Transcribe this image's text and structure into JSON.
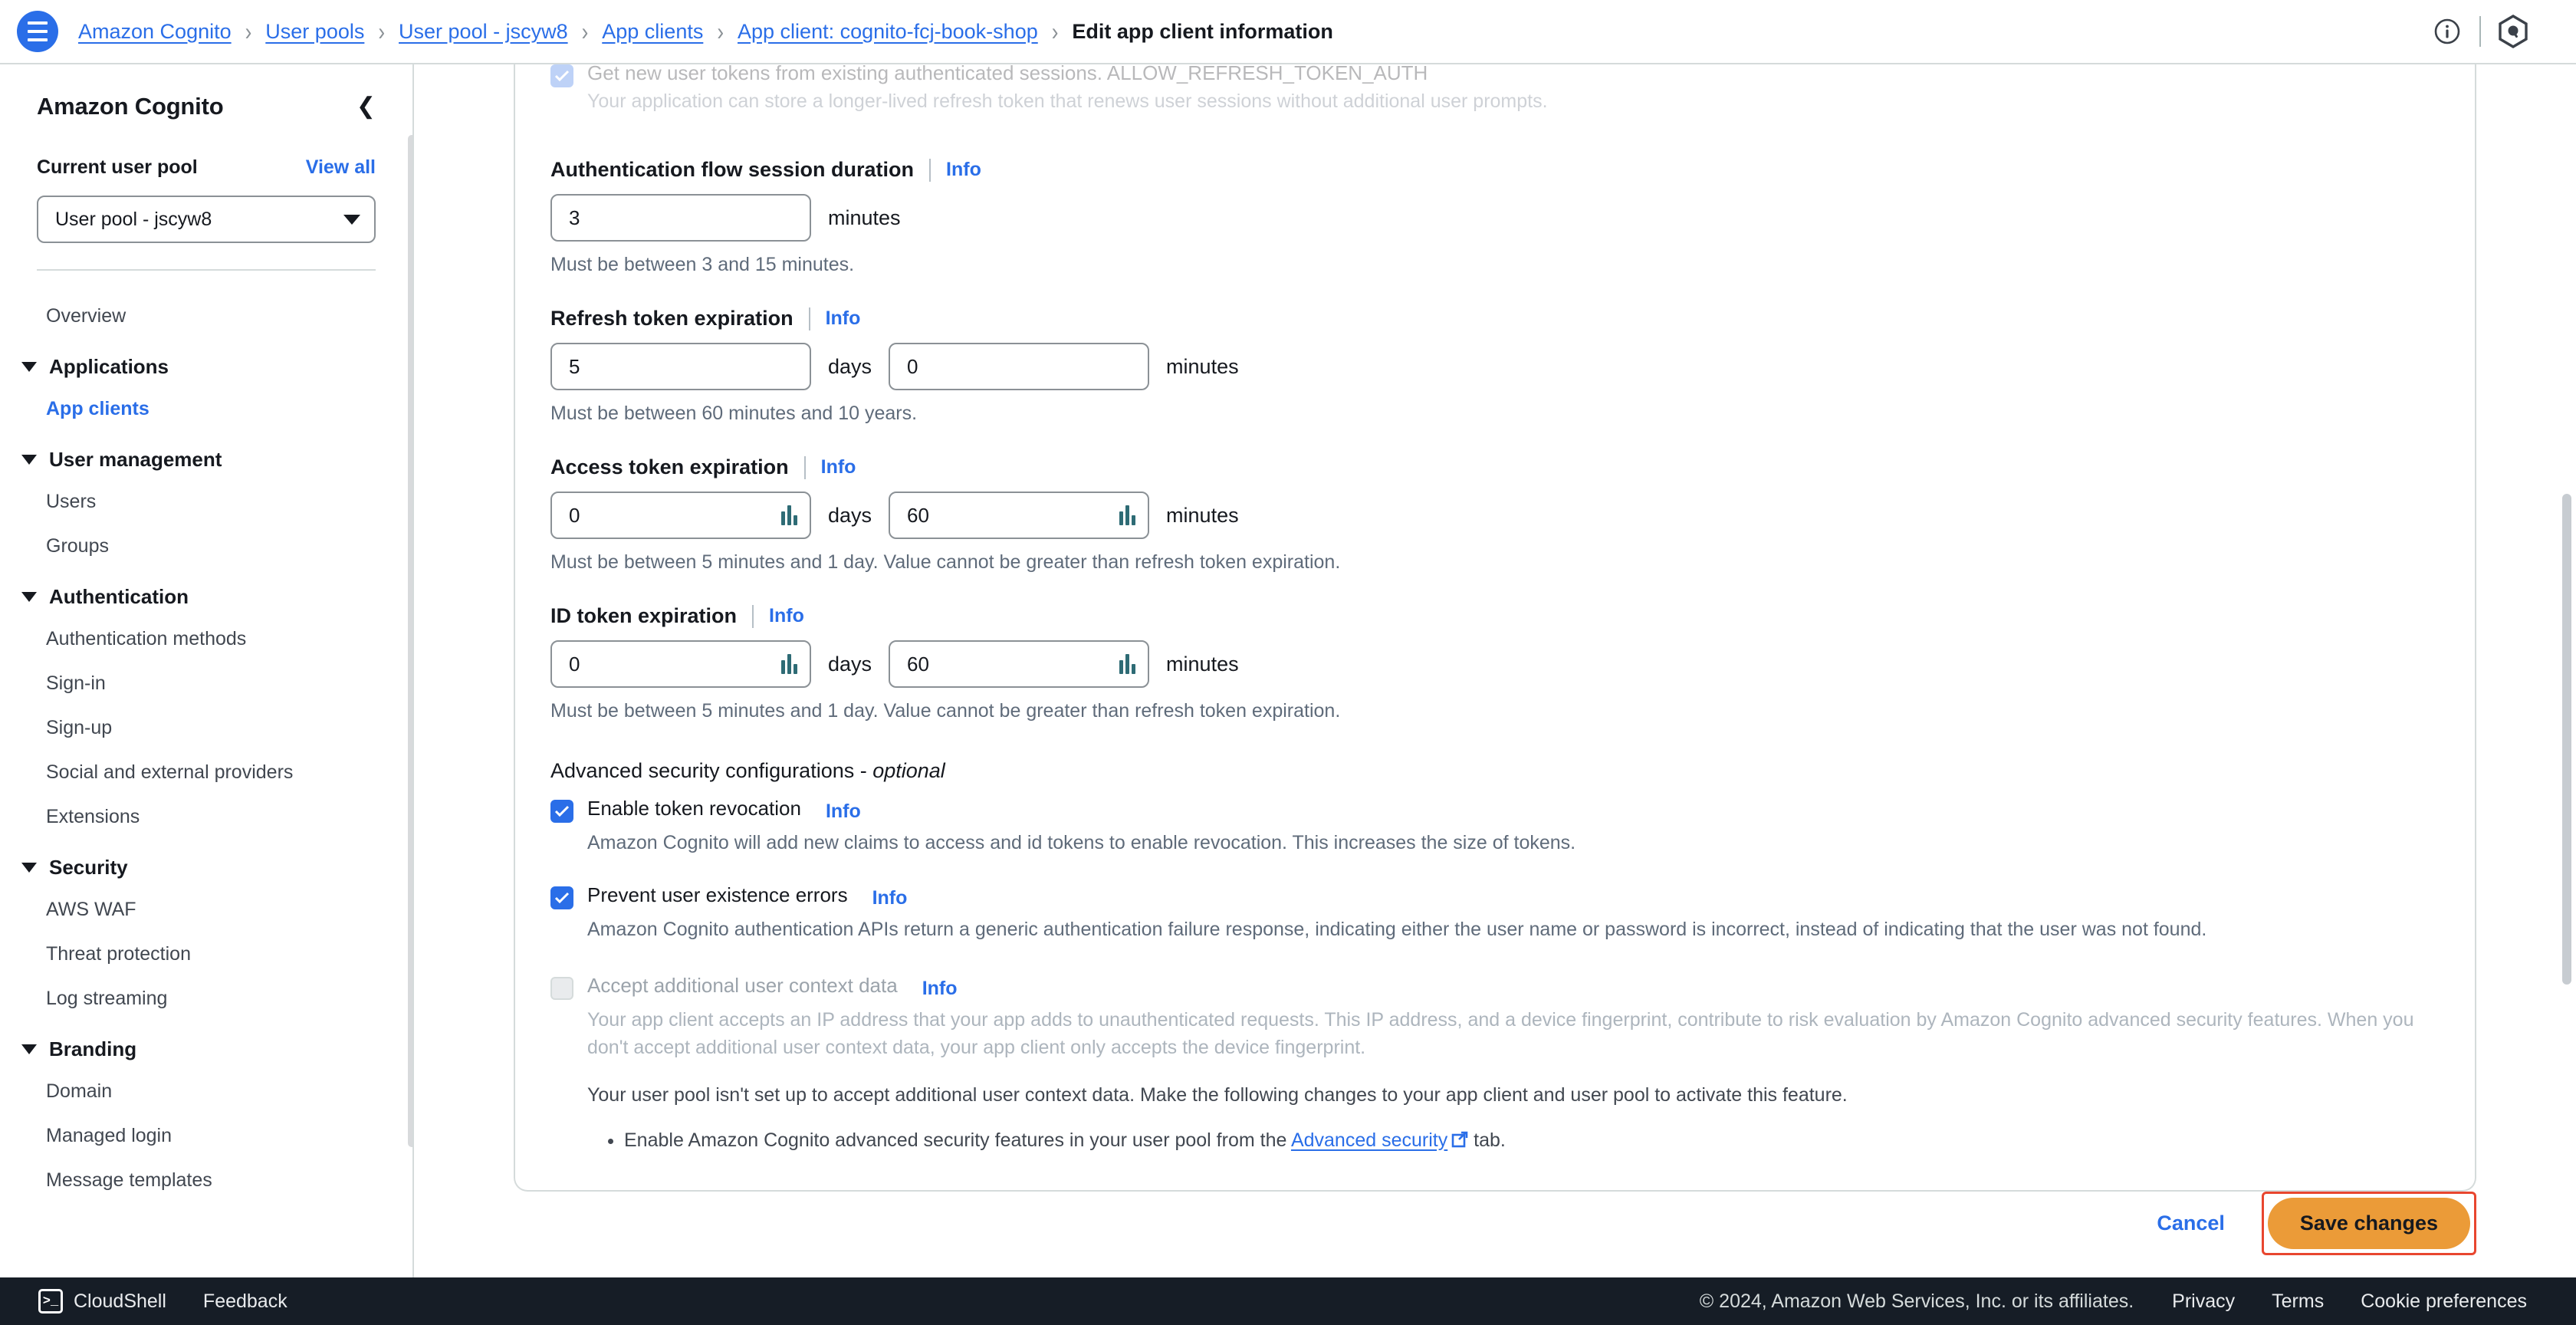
{
  "topnav": {
    "menu_icon": "hamburger-menu-icon",
    "breadcrumbs": [
      {
        "label": "Amazon Cognito",
        "current": false
      },
      {
        "label": "User pools",
        "current": false
      },
      {
        "label": "User pool - jscyw8",
        "current": false
      },
      {
        "label": "App clients",
        "current": false
      },
      {
        "label": "App client: cognito-fcj-book-shop",
        "current": false
      },
      {
        "label": "Edit app client information",
        "current": true
      }
    ],
    "separator": "›",
    "info_icon": "info-circle-icon",
    "assistant_icon": "amazon-q-hexagon-icon"
  },
  "sidebar": {
    "title": "Amazon Cognito",
    "collapse_icon": "chevron-left-icon",
    "current_pool_label": "Current user pool",
    "view_all_label": "View all",
    "pool_select_value": "User pool - jscyw8",
    "nav": [
      {
        "type": "link",
        "label": "Overview",
        "active": false
      },
      {
        "type": "group",
        "label": "Applications",
        "expanded": true
      },
      {
        "type": "link",
        "label": "App clients",
        "active": true
      },
      {
        "type": "group",
        "label": "User management",
        "expanded": true
      },
      {
        "type": "link",
        "label": "Users",
        "active": false
      },
      {
        "type": "link",
        "label": "Groups",
        "active": false
      },
      {
        "type": "group",
        "label": "Authentication",
        "expanded": true
      },
      {
        "type": "link",
        "label": "Authentication methods",
        "active": false
      },
      {
        "type": "link",
        "label": "Sign-in",
        "active": false
      },
      {
        "type": "link",
        "label": "Sign-up",
        "active": false
      },
      {
        "type": "link",
        "label": "Social and external providers",
        "active": false
      },
      {
        "type": "link",
        "label": "Extensions",
        "active": false
      },
      {
        "type": "group",
        "label": "Security",
        "expanded": true
      },
      {
        "type": "link",
        "label": "AWS WAF",
        "active": false
      },
      {
        "type": "link",
        "label": "Threat protection",
        "active": false
      },
      {
        "type": "link",
        "label": "Log streaming",
        "active": false
      },
      {
        "type": "group",
        "label": "Branding",
        "expanded": true
      },
      {
        "type": "link",
        "label": "Domain",
        "active": false
      },
      {
        "type": "link",
        "label": "Managed login",
        "active": false
      },
      {
        "type": "link",
        "label": "Message templates",
        "active": false
      }
    ]
  },
  "form": {
    "cutoff_checkbox": {
      "label": "Get new user tokens from existing authenticated sessions. ALLOW_REFRESH_TOKEN_AUTH",
      "description": "Your application can store a longer-lived refresh token that renews user sessions without additional user prompts.",
      "checked": true,
      "disabled": true
    },
    "info_label": "Info",
    "auth_flow_session": {
      "label": "Authentication flow session duration",
      "value": "3",
      "unit": "minutes",
      "hint": "Must be between 3 and 15 minutes."
    },
    "refresh_token": {
      "label": "Refresh token expiration",
      "days_value": "5",
      "days_unit": "days",
      "minutes_value": "0",
      "minutes_unit": "minutes",
      "hint": "Must be between 60 minutes and 10 years."
    },
    "access_token": {
      "label": "Access token expiration",
      "days_value": "0",
      "days_unit": "days",
      "minutes_value": "60",
      "minutes_unit": "minutes",
      "hint": "Must be between 5 minutes and 1 day. Value cannot be greater than refresh token expiration."
    },
    "id_token": {
      "label": "ID token expiration",
      "days_value": "0",
      "days_unit": "days",
      "minutes_value": "60",
      "minutes_unit": "minutes",
      "hint": "Must be between 5 minutes and 1 day. Value cannot be greater than refresh token expiration."
    },
    "advanced_section": {
      "title_main": "Advanced security configurations - ",
      "title_optional": "optional"
    },
    "token_revocation": {
      "label": "Enable token revocation",
      "checked": true,
      "description": "Amazon Cognito will add new claims to access and id tokens to enable revocation. This increases the size of tokens."
    },
    "prevent_user_existence": {
      "label": "Prevent user existence errors",
      "checked": true,
      "description": "Amazon Cognito authentication APIs return a generic authentication failure response, indicating either the user name or password is incorrect, instead of indicating that the user was not found."
    },
    "user_context_data": {
      "label": "Accept additional user context data",
      "checked": false,
      "disabled": true,
      "description": "Your app client accepts an IP address that your app adds to unauthenticated requests. This IP address, and a device fingerprint, contribute to risk evaluation by Amazon Cognito advanced security features. When you don't accept additional user context data, your app client only accepts the device fingerprint.",
      "note": "Your user pool isn't set up to accept additional user context data. Make the following changes to your app client and user pool to activate this feature.",
      "bullet_prefix": "Enable Amazon Cognito advanced security features in your user pool from the ",
      "bullet_link": "Advanced security",
      "bullet_link_icon": "external-link-icon",
      "bullet_suffix": " tab."
    },
    "stepper_icon": "number-stepper-icon"
  },
  "actions": {
    "cancel_label": "Cancel",
    "save_label": "Save changes",
    "save_bg": "#eb9b38",
    "highlight_border": "#e8462f"
  },
  "bottombar": {
    "cloudshell_icon": "cloudshell-terminal-icon",
    "cloudshell_label": "CloudShell",
    "feedback_label": "Feedback",
    "copyright": "© 2024, Amazon Web Services, Inc. or its affiliates.",
    "links": [
      "Privacy",
      "Terms",
      "Cookie preferences"
    ]
  }
}
